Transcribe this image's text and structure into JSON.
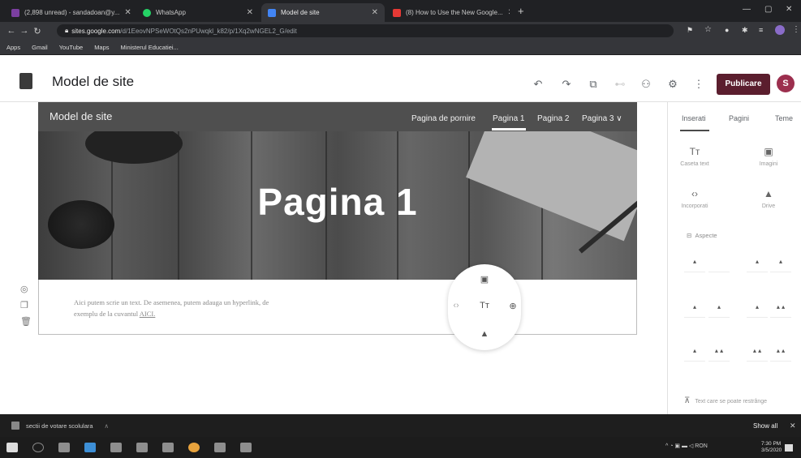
{
  "browser": {
    "tabs": [
      {
        "title": "(2,898 unread) - sandadoan@y...",
        "active": false,
        "favicon_color": "#7b3fa0"
      },
      {
        "title": "WhatsApp",
        "active": false,
        "favicon_color": "#25d366"
      },
      {
        "title": "Model de site",
        "active": true,
        "favicon_color": "#4285f4"
      },
      {
        "title": "(8) How to Use the New Google...",
        "active": false,
        "favicon_color": "#e53935"
      }
    ],
    "new_tab": "+",
    "url_host": "sites.google.com",
    "url_path": "/d/1EeovNPSeWOtQs2nPUwqkl_k82/p/1Xq2wNGEL2_G/edit",
    "bookmarks": [
      "Apps",
      "Gmail",
      "YouTube",
      "Maps",
      "Ministerul Educatiei..."
    ]
  },
  "editor": {
    "site_name": "Model de site",
    "publish_label": "Publicare",
    "avatar_letter": "S",
    "accent_color": "#5b1e2e"
  },
  "page": {
    "bar_title": "Model de site",
    "nav": [
      "Pagina de pornire",
      "Pagina 1",
      "Pagina 2",
      "Pagina 3 ∨"
    ],
    "hero_title": "Pagina 1",
    "body_text": "Aici putem scrie un text. De asemenea, putem adauga un hyperlink, de exemplu de la cuvantul",
    "body_link": "AICI."
  },
  "panel": {
    "tabs": [
      "Inserati",
      "Pagini",
      "Teme"
    ],
    "tiles": [
      {
        "icon": "Tт",
        "label": "Caseta text"
      },
      {
        "icon": "▣",
        "label": "Imagini"
      },
      {
        "icon": "‹›",
        "label": "Incorporati"
      },
      {
        "icon": "▲",
        "label": "Drive"
      }
    ],
    "layouts_label": "Aspecte",
    "collapsible_label": "Text care se poate restrânge"
  },
  "downloads": {
    "file": "sectii de votare scolulara",
    "show_all": "Show all"
  },
  "taskbar": {
    "tray_text": "RON",
    "time": "7:30 PM",
    "date": "3/5/2020"
  }
}
